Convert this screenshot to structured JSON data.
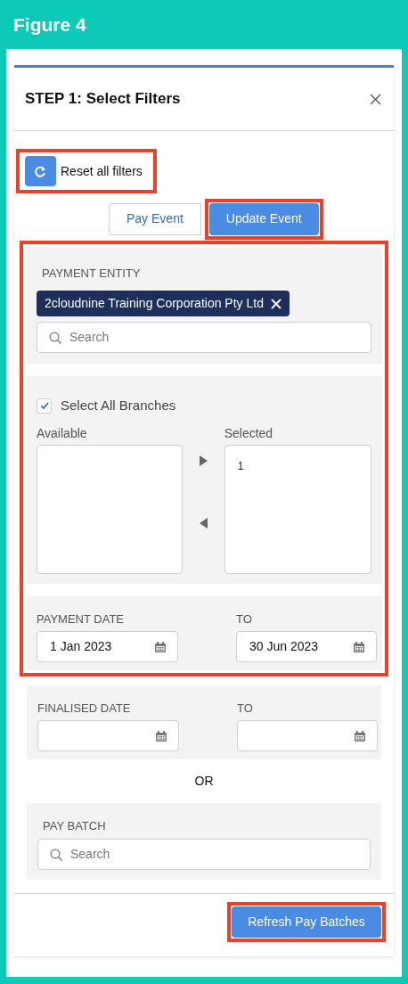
{
  "figure_title": "Figure 4",
  "dialog_title": "STEP 1: Select Filters",
  "reset_button": {
    "label": "Reset all filters",
    "highlighted": true
  },
  "tabs": [
    {
      "label": "Pay Event",
      "selected": false,
      "highlighted": false
    },
    {
      "label": "Update Event",
      "selected": true,
      "highlighted": true
    }
  ],
  "sections": [
    {
      "kind": "lookup",
      "label": "PAYMENT ENTITY",
      "pills": [
        {
          "label": "2cloudnine Training Corporation Pty Ltd"
        }
      ],
      "placeholder": "Search",
      "highlighted": true
    },
    {
      "kind": "dual_list",
      "checkbox_label": "Select All Branches",
      "checked": true,
      "available_label": "Available",
      "selected_label": "Selected",
      "selected_items": [
        "1"
      ],
      "highlighted": true
    },
    {
      "kind": "date_range",
      "label": "PAYMENT DATE",
      "to_label": "TO",
      "from_value": "1 Jan 2023",
      "to_value": "30 Jun 2023",
      "highlighted": true
    },
    {
      "kind": "date_range",
      "label": "FINALISED DATE",
      "to_label": "TO",
      "highlighted": false
    },
    {
      "kind": "separator",
      "text": "OR",
      "highlighted": false
    },
    {
      "kind": "lookup",
      "label": "PAY BATCH",
      "placeholder": "Search",
      "highlighted": false
    }
  ],
  "footer_button": {
    "label": "Refresh Pay Batches",
    "highlighted": true
  }
}
